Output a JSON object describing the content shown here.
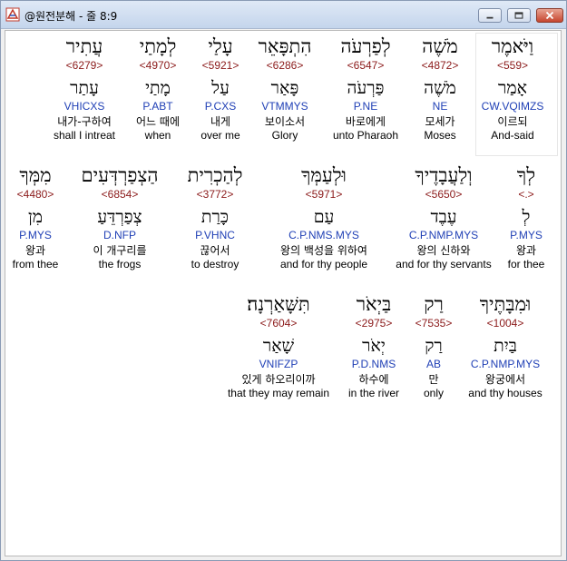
{
  "window": {
    "title": "@원전분해 - 줄 8:9",
    "controls": {
      "minimize": "minimize",
      "maximize": "maximize",
      "close": "close"
    }
  },
  "rows": [
    {
      "words": [
        {
          "heb": "עֲתִיר",
          "num": "<6279>",
          "root": "עָתַר",
          "parse": "VHICXS",
          "kor": "내가-구하여",
          "eng": "shall I intreat"
        },
        {
          "heb": "לְמָתַי",
          "num": "<4970>",
          "root": "מָתַי",
          "parse": "P.ABT",
          "kor": "어느 때에",
          "eng": "when"
        },
        {
          "heb": "עָלַי",
          "num": "<5921>",
          "root": "עַל",
          "parse": "P.CXS",
          "kor": "내게",
          "eng": "over me"
        },
        {
          "heb": "הִתְפָּאֵר",
          "num": "<6286>",
          "root": "פָּאַר",
          "parse": "VTMMYS",
          "kor": "보이소서",
          "eng": "Glory"
        },
        {
          "heb": "לְפַרְעֹה",
          "num": "<6547>",
          "root": "פַּרְעֹה",
          "parse": "P.NE",
          "kor": "바로에게",
          "eng": "unto Pharaoh"
        },
        {
          "heb": "מֹשֶׁה",
          "num": "<4872>",
          "root": "מֹשֶׁה",
          "parse": "NE",
          "kor": "모세가",
          "eng": "Moses"
        },
        {
          "heb": "וַיֹּאמֶר",
          "num": "<559>",
          "root": "אָמַר",
          "parse": "CW.VQIMZS",
          "kor": "이르되",
          "eng": "And-said",
          "selected": "yes"
        }
      ]
    },
    {
      "words": [
        {
          "heb": "מִמְּךָ",
          "num": "<4480>",
          "root": "מִן",
          "parse": "P.MYS",
          "kor": "왕과",
          "eng": "from thee"
        },
        {
          "heb": "הַצְפַרְדְּעִים",
          "num": "<6854>",
          "root": "צְפַרְדֵּעַ",
          "parse": "D.NFP",
          "kor": "이 개구리를",
          "eng": "the frogs"
        },
        {
          "heb": "לְהַכְרִית",
          "num": "<3772>",
          "root": "כָּרַת",
          "parse": "P.VHNC",
          "kor": "끊어서",
          "eng": "to destroy"
        },
        {
          "heb": "וּלְעַמְּךָ",
          "num": "<5971>",
          "root": "עַם",
          "parse": "C.P.NMS.MYS",
          "kor": "왕의 백성을 위하여",
          "eng": "and for thy people"
        },
        {
          "heb": "וְלַעֲבָדֶיךָ",
          "num": "<5650>",
          "root": "עֶבֶד",
          "parse": "C.P.NMP.MYS",
          "kor": "왕의 신하와",
          "eng": "and for thy servants"
        },
        {
          "heb": "לְךָ",
          "num": "<.>",
          "root": "לְ",
          "parse": "P.MYS",
          "kor": "왕과",
          "eng": "for thee"
        }
      ]
    },
    {
      "words": [
        {
          "heb": "תִּשָּׁאַרְנָה׃",
          "num": "<7604>",
          "root": "שָׁאַר",
          "parse": "VNIFZP",
          "kor": "있게 하오리이까",
          "eng": "that they may remain"
        },
        {
          "heb": "בַּיְאֹר",
          "num": "<2975>",
          "root": "יְאֹר",
          "parse": "P.D.NMS",
          "kor": "하수에",
          "eng": "in the river"
        },
        {
          "heb": "רַק",
          "num": "<7535>",
          "root": "רַק",
          "parse": "AB",
          "kor": "만",
          "eng": "only"
        },
        {
          "heb": "וּמִבָּתֶּיךָ",
          "num": "<1004>",
          "root": "בַּיִת",
          "parse": "C.P.NMP.MYS",
          "kor": "왕궁에서",
          "eng": "and thy houses"
        }
      ]
    }
  ]
}
